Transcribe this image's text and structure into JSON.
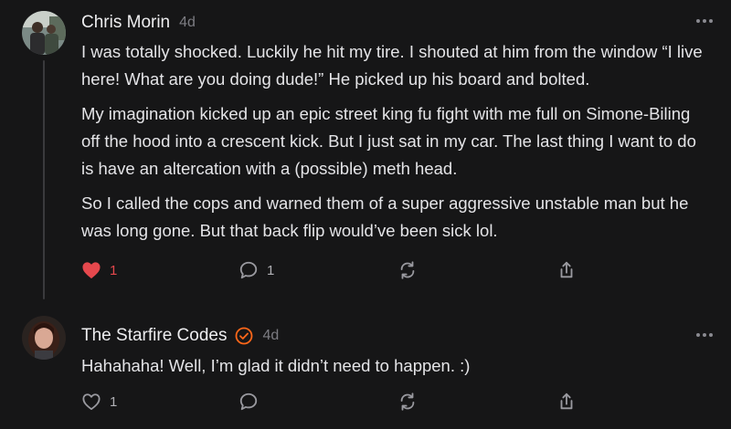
{
  "comments": [
    {
      "author": "Chris Morin",
      "time": "4d",
      "paragraphs": [
        "I was totally shocked. Luckily he hit my tire. I shouted at him from the window “I live here! What are you doing dude!” He picked up his board and bolted.",
        "My imagination kicked up an epic street king fu fight with me full on Simone-Biling off the hood into a crescent kick. But I just sat in my car. The last thing I want to do is have an altercation with a (possible) meth head.",
        "So I called the cops and warned them of a super aggressive unstable man but he was long gone. But that back flip would’ve been sick lol."
      ],
      "likes": "1",
      "liked": true,
      "replies": "1",
      "icons": {
        "like": "heart-icon",
        "reply": "speech-bubble-icon",
        "restack": "restack-icon",
        "share": "share-icon",
        "more": "more-dots-icon"
      },
      "colors": {
        "liked": "#e5484d"
      }
    },
    {
      "author": "The Starfire Codes",
      "time": "4d",
      "verified": true,
      "paragraphs": [
        "Hahahaha! Well, I’m glad it didn’t need to happen. :)"
      ],
      "likes": "1",
      "liked": false,
      "replies": "",
      "colors": {
        "verified_badge": "#ff6719"
      }
    }
  ]
}
